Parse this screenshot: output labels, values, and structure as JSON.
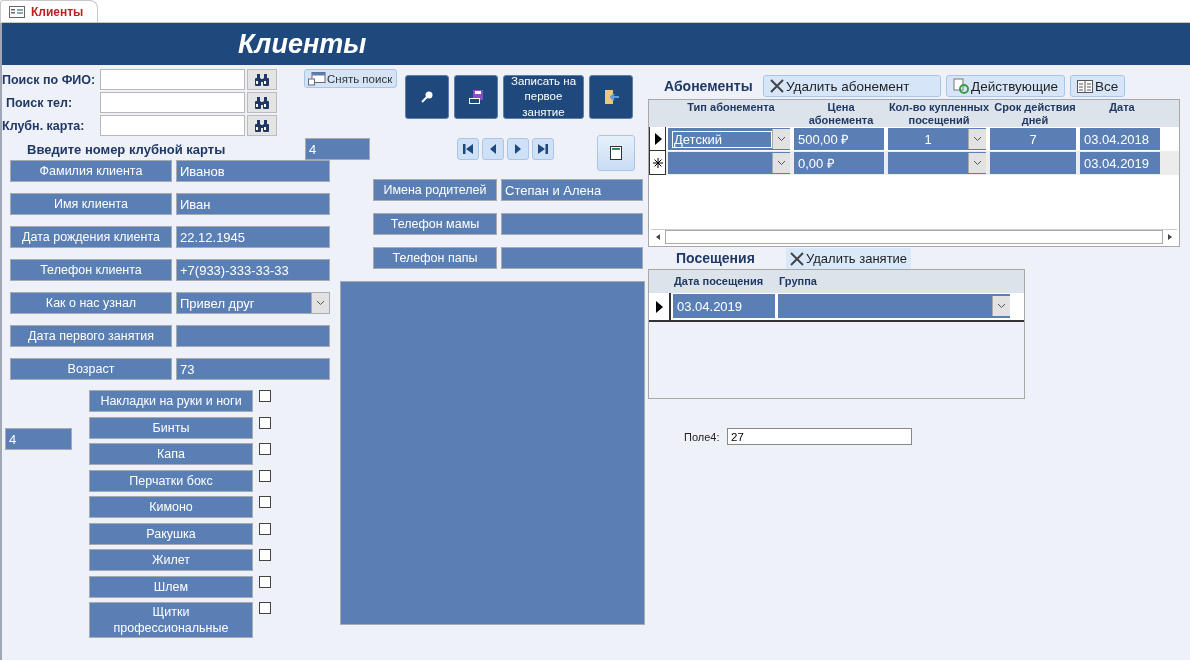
{
  "tab": {
    "title": "Клиенты"
  },
  "header": {
    "title": "Клиенты"
  },
  "search": [
    {
      "label": "Поиск по ФИО:"
    },
    {
      "label": "Поиск тел:"
    },
    {
      "label": "Клубн. карта:"
    }
  ],
  "clear_search_button": "Снять поиск",
  "action_buttons": [
    {
      "kind": "search"
    },
    {
      "kind": "save"
    },
    {
      "kind": "text",
      "label": "Записать на первое занятие"
    },
    {
      "kind": "exit"
    }
  ],
  "nav_buttons": [
    {
      "kind": "first"
    },
    {
      "kind": "prev"
    },
    {
      "kind": "next"
    },
    {
      "kind": "last"
    }
  ],
  "club_card": {
    "label": "Введите номер клубной карты",
    "value": "4"
  },
  "client_fields": [
    {
      "label": "Фамилия клиента",
      "value": "Иванов",
      "kind": "text"
    },
    {
      "label": "Имя клиента",
      "value": "Иван",
      "kind": "text"
    },
    {
      "label": "Дата рождения клиента",
      "value": "22.12.1945",
      "kind": "text"
    },
    {
      "label": "Телефон клиента",
      "value": "+7(933)-333-33-33",
      "kind": "text"
    },
    {
      "label": "Как о нас узнал",
      "value": "Привел друг",
      "kind": "combo"
    },
    {
      "label": "Дата первого занятия",
      "kind": "text"
    },
    {
      "label": "Возраст",
      "value": "73",
      "kind": "text"
    }
  ],
  "parent_fields": [
    {
      "label": "Имена родителей",
      "value": "Степан и Алена"
    },
    {
      "label": "Телефон мамы"
    },
    {
      "label": "Телефон папы"
    }
  ],
  "equipment_count": "4",
  "equipment": [
    {
      "label": "Накладки на руки и ноги",
      "checked": false
    },
    {
      "label": "Бинты",
      "checked": false
    },
    {
      "label": "Капа",
      "checked": false
    },
    {
      "label": "Перчатки бокс",
      "checked": false
    },
    {
      "label": "Кимоно",
      "checked": false
    },
    {
      "label": "Ракушка",
      "checked": false
    },
    {
      "label": "Жилет",
      "checked": false
    },
    {
      "label": "Шлем",
      "checked": false
    },
    {
      "label": "Щитки профессиональные",
      "checked": false
    }
  ],
  "subscriptions": {
    "title": "Абонементы",
    "buttons": [
      {
        "label": "Удалить абонемент",
        "kind": "delete"
      },
      {
        "label": "Действующие",
        "kind": "refresh"
      },
      {
        "label": "Все",
        "kind": "list"
      }
    ],
    "columns": [
      "Тип абонемента",
      "Цена абонемента",
      "Кол-во купленных посещений",
      "Срок действия дней",
      "Дата"
    ],
    "rows": [
      {
        "kind": "record",
        "selected": true,
        "type": "Детский",
        "price": "500,00 ₽",
        "count": "1",
        "days": "7",
        "date": "03.04.2018"
      },
      {
        "kind": "new",
        "selected": false,
        "price": "0,00 ₽",
        "date": "03.04.2019"
      }
    ]
  },
  "visits": {
    "title": "Посещения",
    "delete_button": "Удалить занятие",
    "columns": [
      "Дата посещения",
      "Группа"
    ],
    "rows": [
      {
        "selected": true,
        "date": "03.04.2019"
      }
    ]
  },
  "field4": {
    "label": "Поле4:",
    "value": "27"
  }
}
